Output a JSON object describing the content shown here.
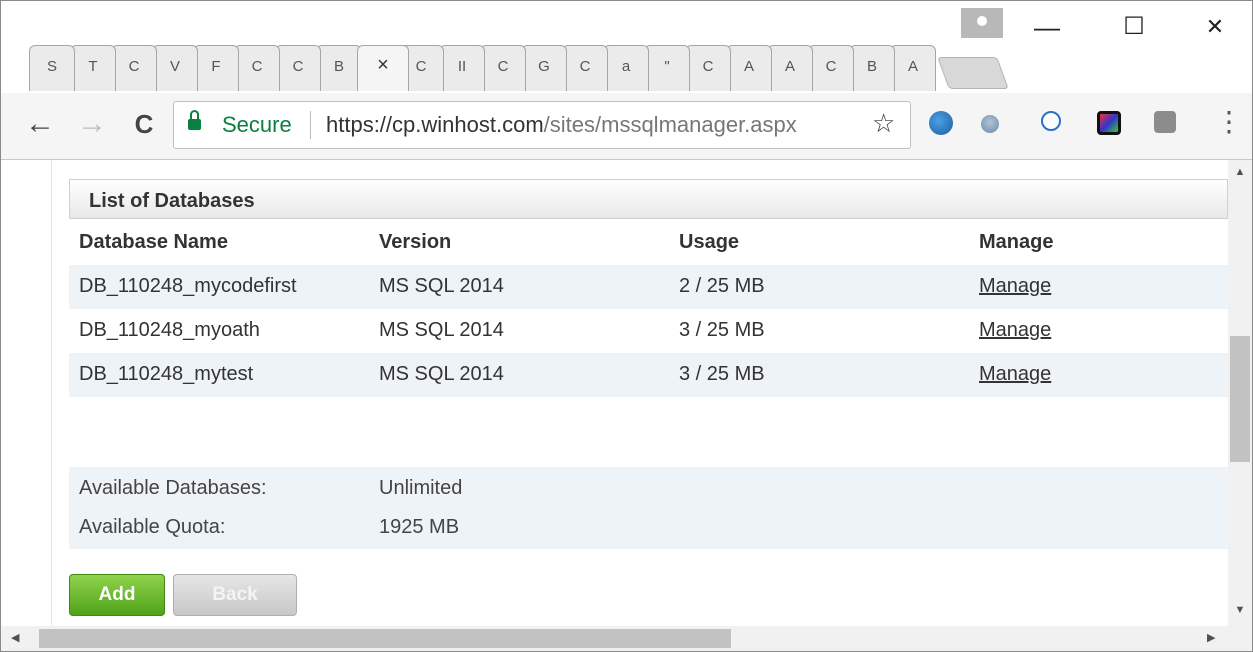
{
  "tabs": {
    "labels": [
      "S",
      "T",
      "C",
      "V",
      "F",
      "C",
      "C",
      "B",
      "×",
      "C",
      "II",
      "C",
      "G",
      "C",
      "a",
      "\"",
      "C",
      "A",
      "A",
      "C",
      "B",
      "A"
    ],
    "active_index": 8
  },
  "window_controls": {
    "minimize": "—",
    "maximize": "☐",
    "close": "✕"
  },
  "nav": {
    "back": "←",
    "forward": "→",
    "reload": "C"
  },
  "address_bar": {
    "secure_label": "Secure",
    "url_host": "https://cp.winhost.com",
    "url_path": "/sites/mssqlmanager.aspx",
    "bookmark_icon": "star-icon"
  },
  "extensions": [
    "globe-icon",
    "satellite-icon",
    "user-badge-icon",
    "dark-app-icon",
    "gray-app-icon"
  ],
  "menu_icon": "⋮",
  "panel": {
    "title": "List of Databases",
    "columns": [
      "Database Name",
      "Version",
      "Usage",
      "Manage"
    ],
    "rows": [
      {
        "name": "DB_110248_mycodefirst",
        "version": "MS SQL 2014",
        "usage": "2 / 25 MB",
        "manage": "Manage"
      },
      {
        "name": "DB_110248_myoath",
        "version": "MS SQL 2014",
        "usage": "3 / 25 MB",
        "manage": "Manage"
      },
      {
        "name": "DB_110248_mytest",
        "version": "MS SQL 2014",
        "usage": "3 / 25 MB",
        "manage": "Manage"
      }
    ],
    "available_databases_label": "Available Databases:",
    "available_databases_value": "Unlimited",
    "available_quota_label": "Available Quota:",
    "available_quota_value": "1925 MB"
  },
  "buttons": {
    "add": "Add",
    "back": "Back"
  },
  "colors": {
    "secure_green": "#0b8043",
    "add_green": "#6bbd2f",
    "link_blue": "#1a4d8f",
    "alt_row": "#eef3f8"
  }
}
